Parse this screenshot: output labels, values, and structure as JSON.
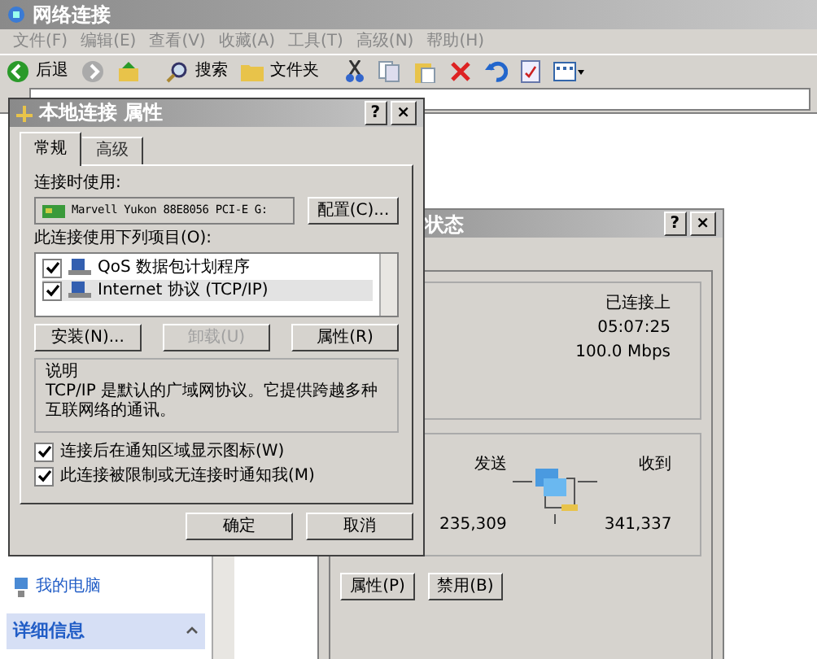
{
  "window": {
    "title": "网络连接"
  },
  "menu": [
    {
      "label": "文件(F)"
    },
    {
      "label": "编辑(E)"
    },
    {
      "label": "查看(V)"
    },
    {
      "label": "收藏(A)"
    },
    {
      "label": "工具(T)"
    },
    {
      "label": "高级(N)"
    },
    {
      "label": "帮助(H)"
    }
  ],
  "toolbar": {
    "back": "后退",
    "search": "搜索",
    "folders": "文件夹"
  },
  "sidebar": {
    "items": [
      {
        "label": "我的电脑"
      }
    ],
    "section": {
      "title": "详细信息",
      "expanded": true
    }
  },
  "status_dialog": {
    "title": "状态",
    "status": "已连接上",
    "duration": "05:07:25",
    "speed": "100.0 Mbps",
    "sent_label": "发送",
    "received_label": "收到",
    "sent": "235,309",
    "received": "341,337",
    "buttons": [
      {
        "label": "属性(P)"
      },
      {
        "label": "禁用(B)"
      }
    ]
  },
  "properties_dialog": {
    "title": "本地连接 属性",
    "help": "?",
    "close": "×",
    "tabs": [
      {
        "label": "常规",
        "selected": true
      },
      {
        "label": "高级",
        "selected": false
      }
    ],
    "connect_using_label": "连接时使用:",
    "adapter": "Marvell Yukon 88E8056 PCI-E G:",
    "configure": "配置(C)...",
    "items_label": "此连接使用下列项目(O):",
    "items": [
      {
        "label": "QoS 数据包计划程序",
        "checked": true,
        "selected": false
      },
      {
        "label": "Internet 协议 (TCP/IP)",
        "checked": true,
        "selected": true
      }
    ],
    "item_buttons": [
      {
        "label": "安装(N)...",
        "disabled": false
      },
      {
        "label": "卸载(U)",
        "disabled": true
      },
      {
        "label": "属性(R)",
        "disabled": false
      }
    ],
    "description_title": "说明",
    "description": "TCP/IP 是默认的广域网协议。它提供跨越多种互联网络的通讯。",
    "options": [
      {
        "label": "连接后在通知区域显示图标(W)",
        "checked": true
      },
      {
        "label": "此连接被限制或无连接时通知我(M)",
        "checked": true
      }
    ],
    "footer_buttons": [
      {
        "label": "确定"
      },
      {
        "label": "取消"
      }
    ]
  }
}
